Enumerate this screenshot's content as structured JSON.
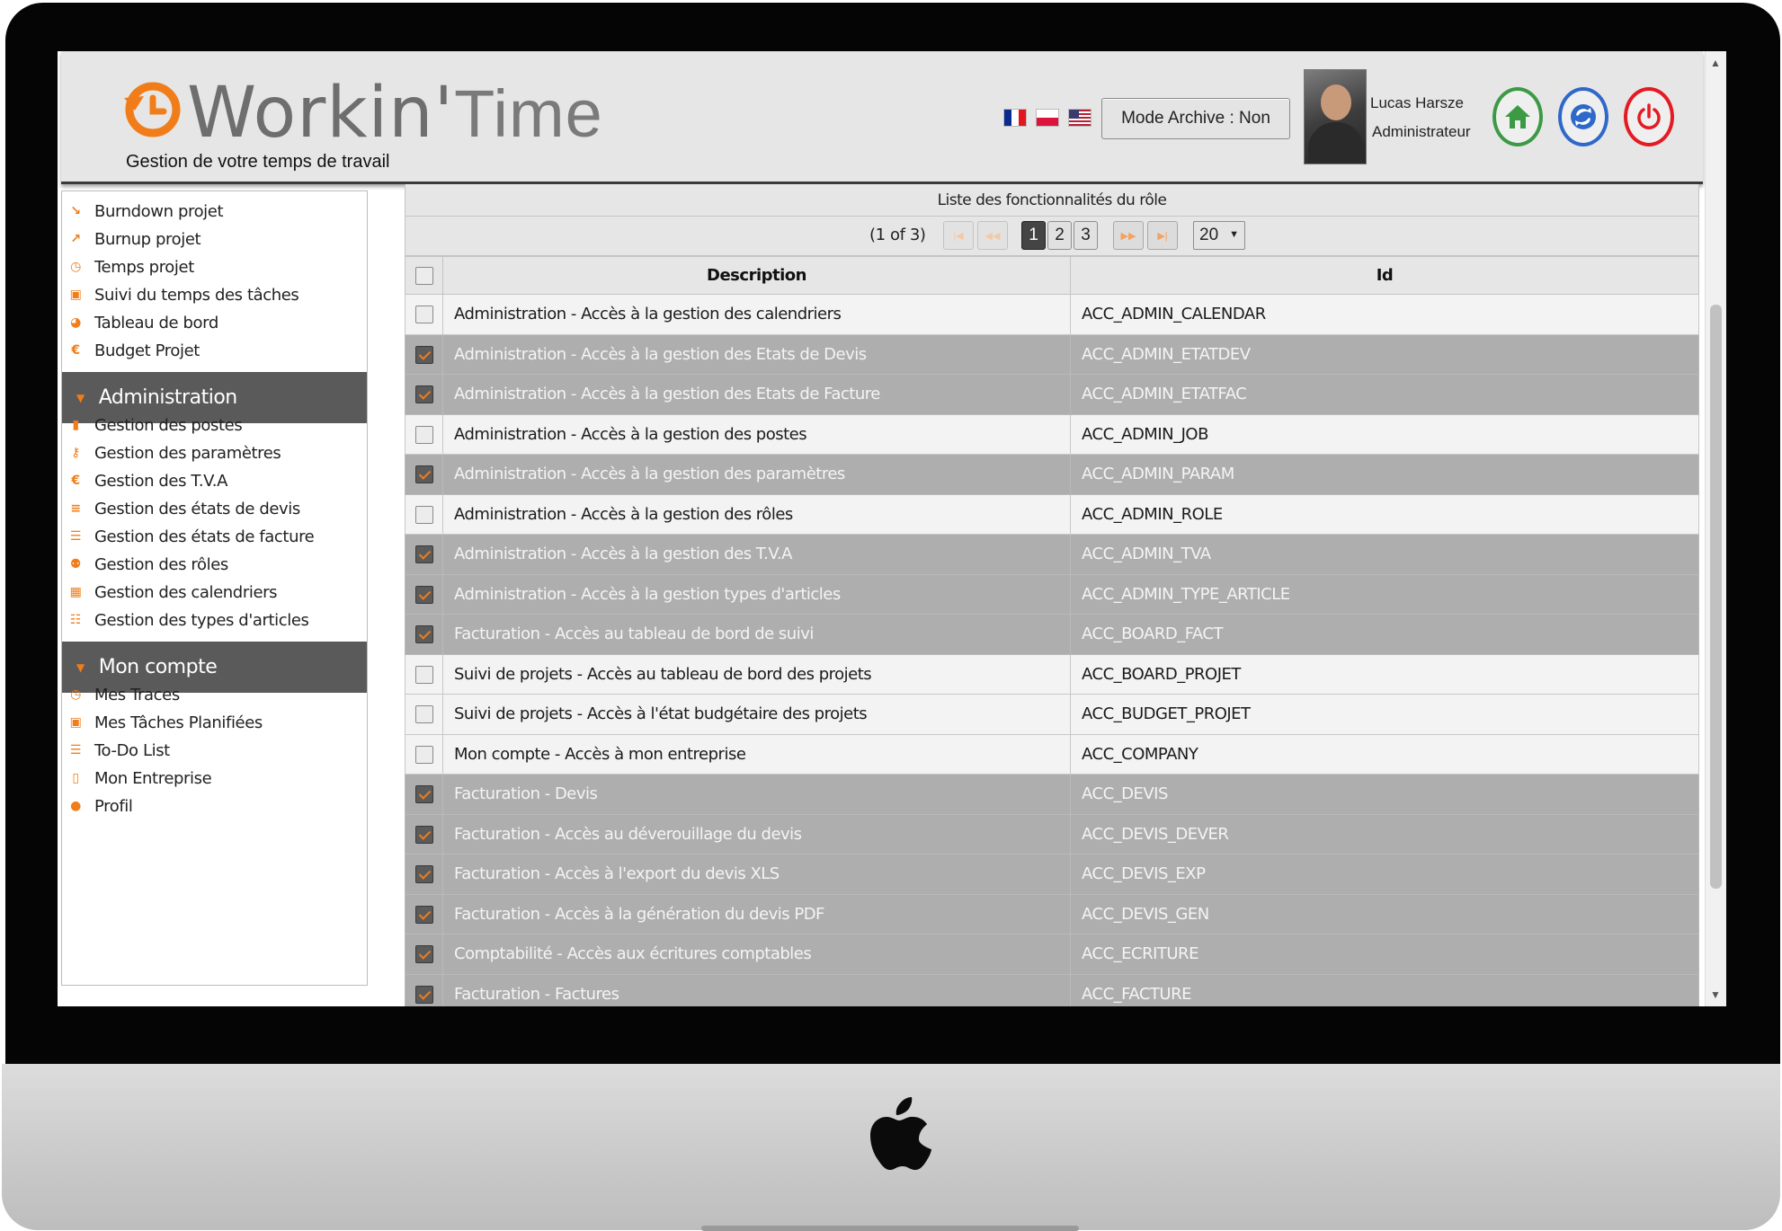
{
  "header": {
    "logo_main": "Workin'",
    "logo_secondary": "Time",
    "tagline": "Gestion de votre temps de travail",
    "archive_button": "Mode Archive : Non",
    "user_name": "Lucas Harsze",
    "user_role": "Administrateur"
  },
  "sidebar": {
    "top_items": [
      {
        "label": "Burndown projet",
        "icon": "burndown-chart-icon"
      },
      {
        "label": "Burnup projet",
        "icon": "burnup-chart-icon"
      },
      {
        "label": "Temps projet",
        "icon": "clock-icon"
      },
      {
        "label": "Suivi du temps des tâches",
        "icon": "calendar-check-icon"
      },
      {
        "label": "Tableau de bord",
        "icon": "pie-chart-icon"
      },
      {
        "label": "Budget Projet",
        "icon": "euro-icon"
      }
    ],
    "admin_section": "Administration",
    "admin_items": [
      {
        "label": "Gestion des postes",
        "icon": "briefcase-icon"
      },
      {
        "label": "Gestion des paramètres",
        "icon": "key-icon"
      },
      {
        "label": "Gestion des T.V.A",
        "icon": "euro-icon"
      },
      {
        "label": "Gestion des états de devis",
        "icon": "list-icon"
      },
      {
        "label": "Gestion des états de facture",
        "icon": "tasks-icon"
      },
      {
        "label": "Gestion des rôles",
        "icon": "users-icon"
      },
      {
        "label": "Gestion des calendriers",
        "icon": "calendar-icon"
      },
      {
        "label": "Gestion des types d'articles",
        "icon": "list-alt-icon"
      }
    ],
    "account_section": "Mon compte",
    "account_items": [
      {
        "label": "Mes Traces",
        "icon": "clock-icon"
      },
      {
        "label": "Mes Tâches Planifiées",
        "icon": "calendar-check-icon"
      },
      {
        "label": "To-Do List",
        "icon": "tasks-icon"
      },
      {
        "label": "Mon Entreprise",
        "icon": "building-icon"
      },
      {
        "label": "Profil",
        "icon": "user-icon"
      }
    ]
  },
  "content": {
    "list_title": "Liste des fonctionnalités du rôle",
    "page_report": "(1 of 3)",
    "pages": [
      "1",
      "2",
      "3"
    ],
    "current_page": "1",
    "rows_per_page": "20",
    "columns": {
      "description": "Description",
      "id": "Id"
    },
    "rows": [
      {
        "description": "Administration - Accès à la gestion des calendriers",
        "id": "ACC_ADMIN_CALENDAR",
        "selected": false
      },
      {
        "description": "Administration - Accès à la gestion des Etats de Devis",
        "id": "ACC_ADMIN_ETATDEV",
        "selected": true
      },
      {
        "description": "Administration - Accès à la gestion des Etats de Facture",
        "id": "ACC_ADMIN_ETATFAC",
        "selected": true
      },
      {
        "description": "Administration - Accès à la gestion des postes",
        "id": "ACC_ADMIN_JOB",
        "selected": false
      },
      {
        "description": "Administration - Accès à la gestion des paramètres",
        "id": "ACC_ADMIN_PARAM",
        "selected": true
      },
      {
        "description": "Administration - Accès à la gestion des rôles",
        "id": "ACC_ADMIN_ROLE",
        "selected": false
      },
      {
        "description": "Administration - Accès à la gestion des T.V.A",
        "id": "ACC_ADMIN_TVA",
        "selected": true
      },
      {
        "description": "Administration - Accès à la gestion types d'articles",
        "id": "ACC_ADMIN_TYPE_ARTICLE",
        "selected": true
      },
      {
        "description": "Facturation - Accès au tableau de bord de suivi",
        "id": "ACC_BOARD_FACT",
        "selected": true
      },
      {
        "description": "Suivi de projets - Accès au tableau de bord des projets",
        "id": "ACC_BOARD_PROJET",
        "selected": false
      },
      {
        "description": "Suivi de projets - Accès à l'état budgétaire des projets",
        "id": "ACC_BUDGET_PROJET",
        "selected": false
      },
      {
        "description": "Mon compte - Accès à mon entreprise",
        "id": "ACC_COMPANY",
        "selected": false
      },
      {
        "description": "Facturation - Devis",
        "id": "ACC_DEVIS",
        "selected": true
      },
      {
        "description": "Facturation - Accès au déverouillage du devis",
        "id": "ACC_DEVIS_DEVER",
        "selected": true
      },
      {
        "description": "Facturation - Accès à l'export du devis XLS",
        "id": "ACC_DEVIS_EXP",
        "selected": true
      },
      {
        "description": "Facturation - Accès à la génération du devis PDF",
        "id": "ACC_DEVIS_GEN",
        "selected": true
      },
      {
        "description": "Comptabilité - Accès aux écritures comptables",
        "id": "ACC_ECRITURE",
        "selected": true
      },
      {
        "description": "Facturation - Factures",
        "id": "ACC_FACTURE",
        "selected": true
      }
    ]
  },
  "colors": {
    "accent_orange": "#f07d1a",
    "home_green": "#3c9a45",
    "sync_blue": "#2e69c9",
    "power_red": "#e31b23",
    "selected_row": "#aeaeae"
  }
}
